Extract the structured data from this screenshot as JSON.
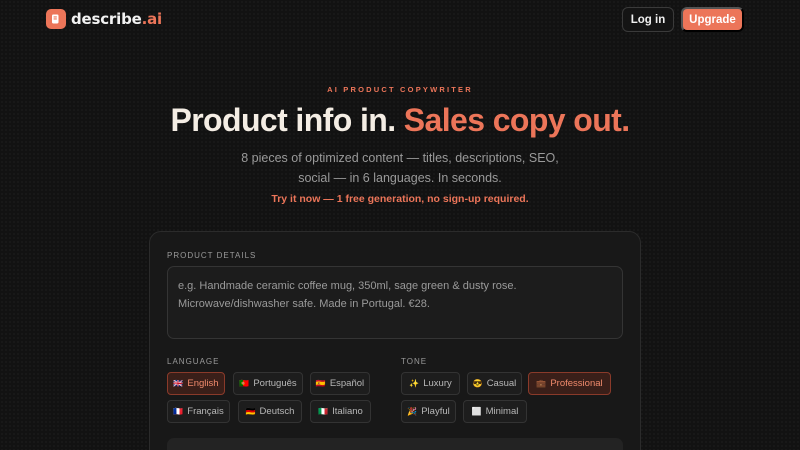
{
  "brand": {
    "name_main": "describe",
    "name_suffix": ".ai",
    "accent_color": "#ec7559"
  },
  "nav": {
    "login_label": "Log in",
    "upgrade_label": "Upgrade"
  },
  "hero": {
    "eyebrow": "AI PRODUCT COPYWRITER",
    "headline_main": "Product info in. ",
    "headline_accent": "Sales copy out.",
    "subtitle_line1": "8 pieces of optimized content — titles, descriptions, SEO,",
    "subtitle_line2": "social — in 6 languages. In seconds.",
    "trial_note": "Try it now — 1 free generation, no sign-up required."
  },
  "form": {
    "product_details_label": "PRODUCT DETAILS",
    "product_details_placeholder": "e.g. Handmade ceramic coffee mug, 350ml, sage green & dusty rose. Microwave/dishwasher safe. Made in Portugal. €28.",
    "language_label": "LANGUAGE",
    "tone_label": "TONE",
    "languages": [
      {
        "icon": "uk-flag-icon",
        "glyph": "🇬🇧",
        "label": "English",
        "selected": true
      },
      {
        "icon": "portugal-flag-icon",
        "glyph": "🇵🇹",
        "label": "Português",
        "selected": false
      },
      {
        "icon": "spain-flag-icon",
        "glyph": "🇪🇸",
        "label": "Español",
        "selected": false
      },
      {
        "icon": "france-flag-icon",
        "glyph": "🇫🇷",
        "label": "Français",
        "selected": false
      },
      {
        "icon": "germany-flag-icon",
        "glyph": "🇩🇪",
        "label": "Deutsch",
        "selected": false
      },
      {
        "icon": "italy-flag-icon",
        "glyph": "🇮🇹",
        "label": "Italiano",
        "selected": false
      }
    ],
    "tones": [
      {
        "icon": "sparkles-icon",
        "glyph": "✨",
        "label": "Luxury",
        "selected": false
      },
      {
        "icon": "sunglasses-face-icon",
        "glyph": "😎",
        "label": "Casual",
        "selected": false
      },
      {
        "icon": "briefcase-icon",
        "glyph": "💼",
        "label": "Professional",
        "selected": true
      },
      {
        "icon": "party-popper-icon",
        "glyph": "🎉",
        "label": "Playful",
        "selected": false
      },
      {
        "icon": "white-square-icon",
        "glyph": "⬜",
        "label": "Minimal",
        "selected": false
      }
    ]
  }
}
